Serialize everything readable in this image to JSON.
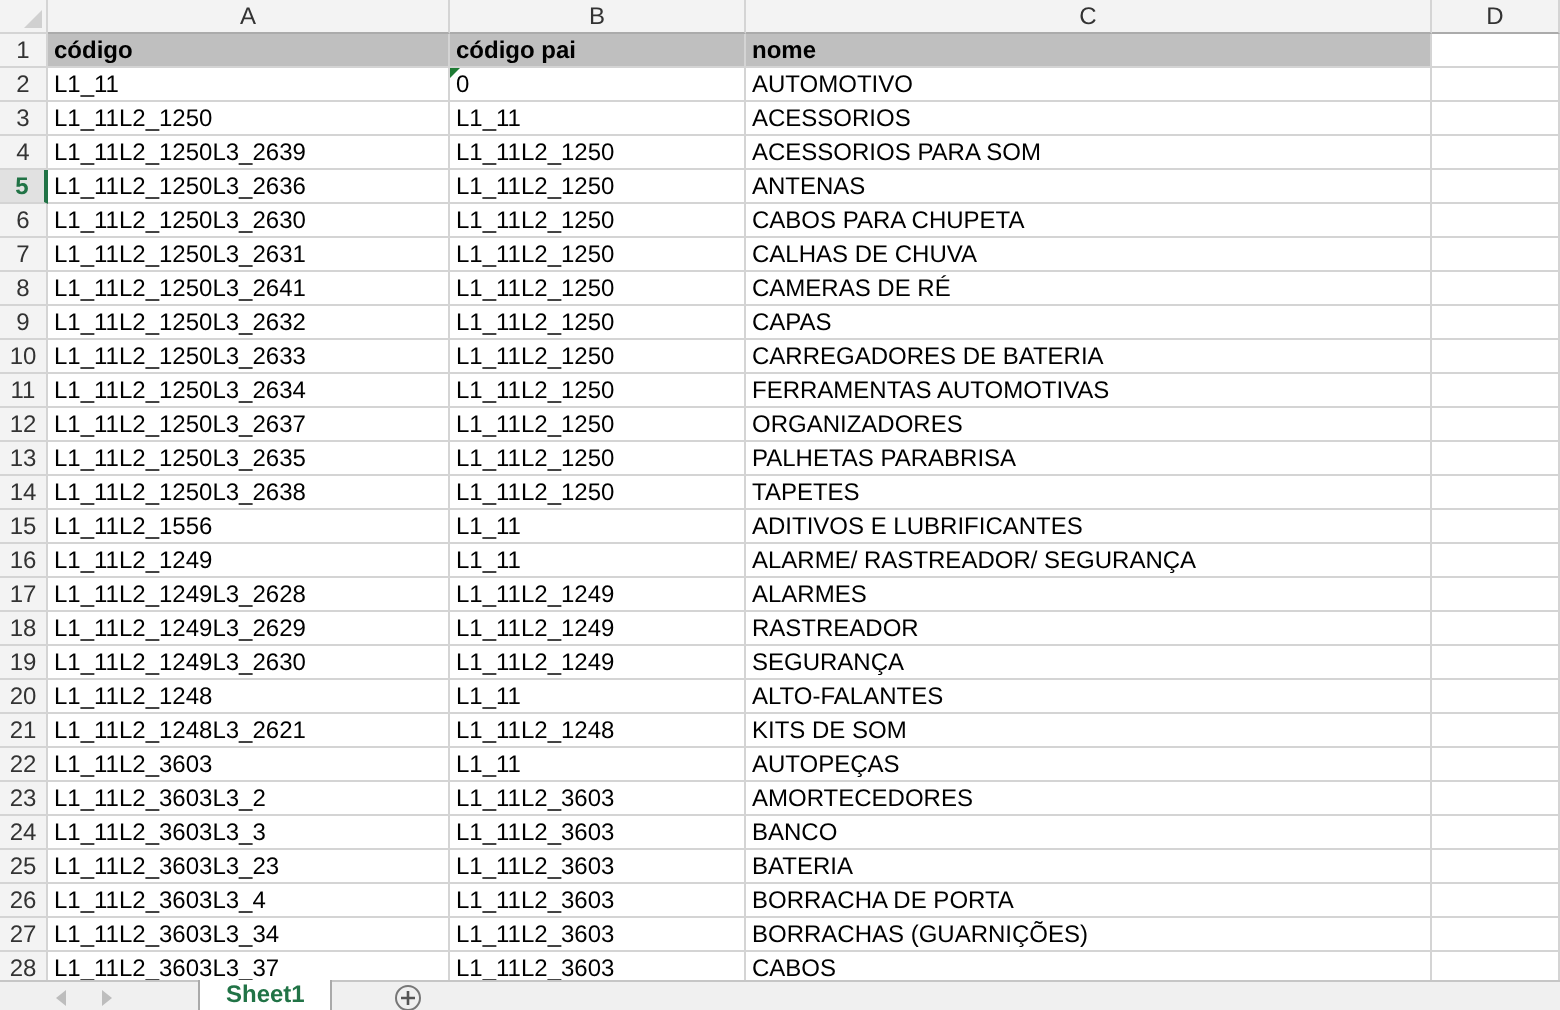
{
  "columns": [
    "A",
    "B",
    "C",
    "D"
  ],
  "rows": [
    {
      "number": "1",
      "kind": "header",
      "selected": false,
      "flagged": false,
      "cells": [
        "código",
        "código pai",
        "nome"
      ]
    },
    {
      "number": "2",
      "kind": "data",
      "selected": false,
      "flagged": true,
      "cells": [
        "L1_11",
        "0",
        "AUTOMOTIVO"
      ]
    },
    {
      "number": "3",
      "kind": "data",
      "selected": false,
      "flagged": false,
      "cells": [
        "L1_11L2_1250",
        "L1_11",
        "ACESSORIOS"
      ]
    },
    {
      "number": "4",
      "kind": "data",
      "selected": false,
      "flagged": false,
      "cells": [
        "L1_11L2_1250L3_2639",
        "L1_11L2_1250",
        "ACESSORIOS PARA SOM"
      ]
    },
    {
      "number": "5",
      "kind": "data",
      "selected": true,
      "flagged": false,
      "cells": [
        "L1_11L2_1250L3_2636",
        "L1_11L2_1250",
        "ANTENAS"
      ]
    },
    {
      "number": "6",
      "kind": "data",
      "selected": false,
      "flagged": false,
      "cells": [
        "L1_11L2_1250L3_2630",
        "L1_11L2_1250",
        "CABOS PARA CHUPETA"
      ]
    },
    {
      "number": "7",
      "kind": "data",
      "selected": false,
      "flagged": false,
      "cells": [
        "L1_11L2_1250L3_2631",
        "L1_11L2_1250",
        "CALHAS DE CHUVA"
      ]
    },
    {
      "number": "8",
      "kind": "data",
      "selected": false,
      "flagged": false,
      "cells": [
        "L1_11L2_1250L3_2641",
        "L1_11L2_1250",
        "CAMERAS DE RÉ"
      ]
    },
    {
      "number": "9",
      "kind": "data",
      "selected": false,
      "flagged": false,
      "cells": [
        "L1_11L2_1250L3_2632",
        "L1_11L2_1250",
        "CAPAS"
      ]
    },
    {
      "number": "10",
      "kind": "data",
      "selected": false,
      "flagged": false,
      "cells": [
        "L1_11L2_1250L3_2633",
        "L1_11L2_1250",
        "CARREGADORES DE BATERIA"
      ]
    },
    {
      "number": "11",
      "kind": "data",
      "selected": false,
      "flagged": false,
      "cells": [
        "L1_11L2_1250L3_2634",
        "L1_11L2_1250",
        "FERRAMENTAS AUTOMOTIVAS"
      ]
    },
    {
      "number": "12",
      "kind": "data",
      "selected": false,
      "flagged": false,
      "cells": [
        "L1_11L2_1250L3_2637",
        "L1_11L2_1250",
        "ORGANIZADORES"
      ]
    },
    {
      "number": "13",
      "kind": "data",
      "selected": false,
      "flagged": false,
      "cells": [
        "L1_11L2_1250L3_2635",
        "L1_11L2_1250",
        "PALHETAS PARABRISA"
      ]
    },
    {
      "number": "14",
      "kind": "data",
      "selected": false,
      "flagged": false,
      "cells": [
        "L1_11L2_1250L3_2638",
        "L1_11L2_1250",
        "TAPETES"
      ]
    },
    {
      "number": "15",
      "kind": "data",
      "selected": false,
      "flagged": false,
      "cells": [
        "L1_11L2_1556",
        "L1_11",
        "ADITIVOS E LUBRIFICANTES"
      ]
    },
    {
      "number": "16",
      "kind": "data",
      "selected": false,
      "flagged": false,
      "cells": [
        "L1_11L2_1249",
        "L1_11",
        "ALARME/ RASTREADOR/ SEGURANÇA"
      ]
    },
    {
      "number": "17",
      "kind": "data",
      "selected": false,
      "flagged": false,
      "cells": [
        "L1_11L2_1249L3_2628",
        "L1_11L2_1249",
        "ALARMES"
      ]
    },
    {
      "number": "18",
      "kind": "data",
      "selected": false,
      "flagged": false,
      "cells": [
        "L1_11L2_1249L3_2629",
        "L1_11L2_1249",
        "RASTREADOR"
      ]
    },
    {
      "number": "19",
      "kind": "data",
      "selected": false,
      "flagged": false,
      "cells": [
        "L1_11L2_1249L3_2630",
        "L1_11L2_1249",
        "SEGURANÇA"
      ]
    },
    {
      "number": "20",
      "kind": "data",
      "selected": false,
      "flagged": false,
      "cells": [
        "L1_11L2_1248",
        "L1_11",
        "ALTO-FALANTES"
      ]
    },
    {
      "number": "21",
      "kind": "data",
      "selected": false,
      "flagged": false,
      "cells": [
        "L1_11L2_1248L3_2621",
        "L1_11L2_1248",
        "KITS DE SOM"
      ]
    },
    {
      "number": "22",
      "kind": "data",
      "selected": false,
      "flagged": false,
      "cells": [
        "L1_11L2_3603",
        "L1_11",
        "AUTOPEÇAS"
      ]
    },
    {
      "number": "23",
      "kind": "data",
      "selected": false,
      "flagged": false,
      "cells": [
        "L1_11L2_3603L3_2",
        "L1_11L2_3603",
        "AMORTECEDORES"
      ]
    },
    {
      "number": "24",
      "kind": "data",
      "selected": false,
      "flagged": false,
      "cells": [
        "L1_11L2_3603L3_3",
        "L1_11L2_3603",
        "BANCO"
      ]
    },
    {
      "number": "25",
      "kind": "data",
      "selected": false,
      "flagged": false,
      "cells": [
        "L1_11L2_3603L3_23",
        "L1_11L2_3603",
        "BATERIA"
      ]
    },
    {
      "number": "26",
      "kind": "data",
      "selected": false,
      "flagged": false,
      "cells": [
        "L1_11L2_3603L3_4",
        "L1_11L2_3603",
        "BORRACHA DE PORTA"
      ]
    },
    {
      "number": "27",
      "kind": "data",
      "selected": false,
      "flagged": false,
      "cells": [
        "L1_11L2_3603L3_34",
        "L1_11L2_3603",
        "BORRACHAS (GUARNIÇÕES)"
      ]
    },
    {
      "number": "28",
      "kind": "data",
      "selected": false,
      "flagged": false,
      "cells": [
        "L1_11L2_3603L3_37",
        "L1_11L2_3603",
        "CABOS"
      ]
    }
  ],
  "sheet_tabs": [
    {
      "label": "Sheet1",
      "selected": true
    }
  ]
}
